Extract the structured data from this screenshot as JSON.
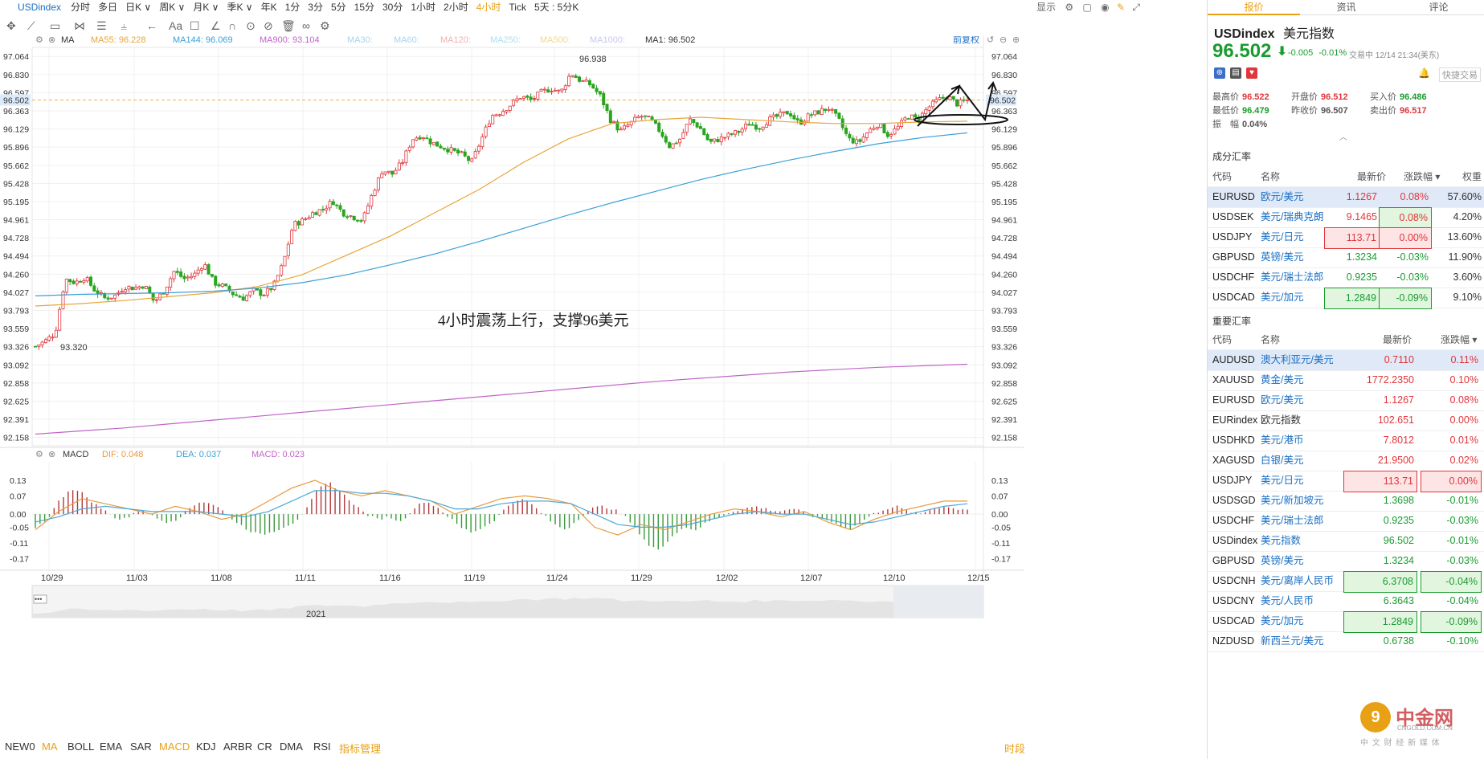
{
  "topbar": {
    "symbol": "USDindex",
    "periods": [
      "分时",
      "多日",
      "日K",
      "周K",
      "月K",
      "季K",
      "年K",
      "1分",
      "3分",
      "5分",
      "15分",
      "30分",
      "1小时",
      "2小时",
      "4小时",
      "Tick",
      "5天 : 5分K"
    ],
    "active_period": "4小时",
    "display": "显示"
  },
  "ma_header": {
    "ma": "MA",
    "ma55": "MA55: 96.228",
    "ma144": "MA144: 96.069",
    "ma900": "MA900: 93.104",
    "ma30": "MA30:",
    "ma60": "MA60:",
    "ma120": "MA120:",
    "ma250": "MA250:",
    "ma500": "MA500:",
    "ma1000": "MA1000:",
    "ma1": "MA1: 96.502",
    "adjust": "前复权"
  },
  "macd_header": {
    "name": "MACD",
    "dif": "DIF: 0.048",
    "dea": "DEA: 0.037",
    "macd": "MACD: 0.023"
  },
  "chart_data": [
    {
      "type": "candlestick",
      "title": "",
      "annotation": "4小时震荡上行，支撑96美元",
      "yticks": [
        97.064,
        96.83,
        96.597,
        96.363,
        96.129,
        95.896,
        95.662,
        95.428,
        95.195,
        94.961,
        94.728,
        94.494,
        94.26,
        94.027,
        93.793,
        93.559,
        93.326,
        93.092,
        92.858,
        92.625,
        92.391,
        92.158
      ],
      "ylim": [
        92.158,
        97.064
      ],
      "current_price": "96.502",
      "high_label": "96.938",
      "low_label": "93.320",
      "xticks": [
        "10/29",
        "11/03",
        "11/08",
        "11/11",
        "11/16",
        "11/19",
        "11/24",
        "11/29",
        "12/02",
        "12/07",
        "12/10",
        "12/15"
      ],
      "close_path": [
        93.33,
        93.4,
        93.5,
        94.2,
        94.15,
        94.22,
        94.05,
        93.95,
        93.98,
        94.1,
        94.08,
        94.12,
        93.9,
        94.05,
        94.3,
        94.2,
        94.25,
        94.4,
        94.15,
        94.1,
        94.0,
        93.95,
        94.05,
        94.0,
        94.1,
        94.4,
        94.9,
        94.95,
        95.05,
        95.1,
        95.2,
        95.05,
        95.0,
        94.95,
        95.3,
        95.6,
        95.55,
        95.7,
        96.0,
        96.05,
        95.95,
        95.9,
        95.85,
        95.8,
        95.7,
        96.0,
        96.3,
        96.35,
        96.45,
        96.55,
        96.5,
        96.6,
        96.65,
        96.6,
        96.85,
        96.75,
        96.7,
        96.55,
        96.25,
        96.1,
        96.2,
        96.3,
        96.25,
        96.1,
        95.9,
        96.0,
        96.25,
        96.15,
        95.95,
        96.0,
        96.05,
        96.1,
        96.2,
        96.15,
        96.25,
        96.3,
        96.35,
        96.2,
        96.3,
        96.35,
        96.4,
        96.25,
        96.0,
        95.95,
        96.1,
        96.2,
        96.05,
        96.15,
        96.3,
        96.25,
        96.4,
        96.5,
        96.55,
        96.45,
        96.5
      ],
      "series": [
        {
          "name": "MA55",
          "color": "#e8a53a",
          "values": [
            93.85,
            93.88,
            93.92,
            93.97,
            94.02,
            94.1,
            94.25,
            94.5,
            94.75,
            95.05,
            95.35,
            95.7,
            96.0,
            96.2,
            96.25,
            96.28,
            96.25,
            96.22,
            96.2,
            96.2,
            96.22,
            96.23
          ]
        },
        {
          "name": "MA144",
          "color": "#3aa0d8",
          "values": [
            93.98,
            94.0,
            94.01,
            94.02,
            94.04,
            94.08,
            94.15,
            94.25,
            94.38,
            94.52,
            94.68,
            94.85,
            95.02,
            95.18,
            95.33,
            95.48,
            95.61,
            95.73,
            95.84,
            95.94,
            96.02,
            96.08
          ]
        },
        {
          "name": "MA900",
          "color": "#c065c8",
          "values": [
            92.2,
            92.24,
            92.28,
            92.33,
            92.38,
            92.43,
            92.48,
            92.53,
            92.58,
            92.63,
            92.68,
            92.73,
            92.78,
            92.83,
            92.88,
            92.92,
            92.96,
            93.0,
            93.03,
            93.06,
            93.08,
            93.1
          ]
        }
      ]
    },
    {
      "type": "bar",
      "title": "MACD",
      "yticks": [
        0.13,
        0.07,
        0.0,
        -0.05,
        -0.11,
        -0.17
      ],
      "ylim": [
        -0.17,
        0.13
      ],
      "histogram": [
        -0.05,
        -0.02,
        0.05,
        0.1,
        0.08,
        0.04,
        0.01,
        -0.02,
        -0.01,
        0.02,
        -0.01,
        -0.03,
        -0.02,
        0.02,
        0.05,
        0.04,
        0.01,
        -0.03,
        -0.06,
        -0.08,
        -0.07,
        -0.05,
        -0.03,
        0.02,
        0.1,
        0.12,
        0.08,
        0.04,
        0.0,
        -0.02,
        -0.01,
        -0.03,
        0.02,
        0.05,
        0.03,
        -0.01,
        -0.05,
        -0.07,
        -0.05,
        -0.02,
        0.03,
        0.06,
        0.04,
        0.0,
        -0.04,
        -0.06,
        -0.02,
        0.02,
        0.03,
        0.02,
        -0.01,
        -0.06,
        -0.12,
        -0.14,
        -0.08,
        -0.05,
        -0.06,
        -0.03,
        -0.01,
        0.01,
        0.02,
        0.03,
        0.02,
        0.01,
        0.02,
        0.01,
        -0.01,
        -0.02,
        -0.04,
        -0.06,
        -0.03,
        0.0,
        0.02,
        0.03,
        0.01,
        0.0,
        0.02,
        0.03,
        0.02,
        0.02
      ],
      "series": [
        {
          "name": "DIF",
          "color": "#e89a3c",
          "values": [
            -0.06,
            0.01,
            0.06,
            0.04,
            0.02,
            0.0,
            0.03,
            0.01,
            -0.02,
            0.0,
            0.05,
            0.1,
            0.13,
            0.09,
            0.07,
            0.09,
            0.07,
            0.05,
            0.0,
            0.03,
            0.06,
            0.07,
            0.06,
            0.04,
            -0.05,
            -0.08,
            -0.04,
            -0.06,
            -0.03,
            0.0,
            0.02,
            0.01,
            -0.01,
            0.01,
            -0.03,
            -0.06,
            -0.02,
            0.01,
            0.03,
            0.05,
            0.05
          ]
        },
        {
          "name": "DEA",
          "color": "#4aa8d8",
          "values": [
            -0.03,
            -0.01,
            0.02,
            0.03,
            0.02,
            0.01,
            0.01,
            0.01,
            0.0,
            -0.01,
            0.01,
            0.05,
            0.09,
            0.09,
            0.08,
            0.08,
            0.07,
            0.05,
            0.02,
            0.02,
            0.04,
            0.05,
            0.05,
            0.04,
            0.0,
            -0.04,
            -0.05,
            -0.05,
            -0.04,
            -0.02,
            0.0,
            0.01,
            0.0,
            0.0,
            -0.02,
            -0.04,
            -0.03,
            -0.01,
            0.01,
            0.03,
            0.04
          ]
        }
      ]
    }
  ],
  "overview": {
    "year": "2021"
  },
  "indicators": [
    "NEW0",
    "MA",
    "BOLL",
    "EMA",
    "SAR",
    "MACD",
    "KDJ",
    "ARBR",
    "CR",
    "DMA",
    "RSI",
    "指标管理"
  ],
  "indicators_active": [
    "MA",
    "MACD",
    "指标管理"
  ],
  "time_label": "时段",
  "side": {
    "tabs": [
      "报价",
      "资讯",
      "评论"
    ],
    "symbol": "USDindex",
    "name": "美元指数",
    "price": "96.502",
    "change": "-0.005",
    "change_pct": "-0.01%",
    "trade_time": "交易中 12/14 21:34(美东)",
    "quick_trade": "快捷交易",
    "stats": [
      {
        "label": "最高价",
        "value": "96.522",
        "color": "red"
      },
      {
        "label": "开盘价",
        "value": "96.512",
        "color": "red"
      },
      {
        "label": "买入价",
        "value": "96.486",
        "color": "grn"
      },
      {
        "label": "最低价",
        "value": "96.479",
        "color": "grn"
      },
      {
        "label": "昨收价",
        "value": "96.507",
        "color": "blk"
      },
      {
        "label": "卖出价",
        "value": "96.517",
        "color": "red"
      },
      {
        "label": "振　幅",
        "value": "0.04%",
        "color": "blk"
      }
    ],
    "components_title": "成分汇率",
    "components_headers": [
      "代码",
      "名称",
      "最新价",
      "涨跌幅",
      "权重"
    ],
    "components": [
      {
        "code": "EURUSD",
        "name": "欧元/美元",
        "price": "1.1267",
        "chg": "0.08%",
        "weight": "57.60%",
        "dir": "up",
        "pbox": "",
        "cbox": ""
      },
      {
        "code": "USDSEK",
        "name": "美元/瑞典克朗",
        "price": "9.1465",
        "chg": "0.08%",
        "weight": "4.20%",
        "dir": "up",
        "pbox": "",
        "cbox": "g"
      },
      {
        "code": "USDJPY",
        "name": "美元/日元",
        "price": "113.71",
        "chg": "0.00%",
        "weight": "13.60%",
        "dir": "up",
        "pbox": "r",
        "cbox": "r"
      },
      {
        "code": "GBPUSD",
        "name": "英镑/美元",
        "price": "1.3234",
        "chg": "-0.03%",
        "weight": "11.90%",
        "dir": "down",
        "pbox": "",
        "cbox": ""
      },
      {
        "code": "USDCHF",
        "name": "美元/瑞士法郎",
        "price": "0.9235",
        "chg": "-0.03%",
        "weight": "3.60%",
        "dir": "down",
        "pbox": "",
        "cbox": ""
      },
      {
        "code": "USDCAD",
        "name": "美元/加元",
        "price": "1.2849",
        "chg": "-0.09%",
        "weight": "9.10%",
        "dir": "down",
        "pbox": "g",
        "cbox": "g"
      }
    ],
    "major_title": "重要汇率",
    "major_headers": [
      "代码",
      "名称",
      "最新价",
      "涨跌幅"
    ],
    "major": [
      {
        "code": "AUDUSD",
        "name": "澳大利亚元/美元",
        "price": "0.7110",
        "chg": "0.11%",
        "dir": "up",
        "pbox": "",
        "cbox": "",
        "link": true
      },
      {
        "code": "XAUUSD",
        "name": "黄金/美元",
        "price": "1772.2350",
        "chg": "0.10%",
        "dir": "up",
        "pbox": "",
        "cbox": "",
        "link": true
      },
      {
        "code": "EURUSD",
        "name": "欧元/美元",
        "price": "1.1267",
        "chg": "0.08%",
        "dir": "up",
        "pbox": "",
        "cbox": "",
        "link": true
      },
      {
        "code": "EURindex",
        "name": "欧元指数",
        "price": "102.651",
        "chg": "0.00%",
        "dir": "up",
        "pbox": "",
        "cbox": "",
        "link": false
      },
      {
        "code": "USDHKD",
        "name": "美元/港币",
        "price": "7.8012",
        "chg": "0.01%",
        "dir": "up",
        "pbox": "",
        "cbox": "",
        "link": true
      },
      {
        "code": "XAGUSD",
        "name": "白银/美元",
        "price": "21.9500",
        "chg": "0.02%",
        "dir": "up",
        "pbox": "",
        "cbox": "",
        "link": true
      },
      {
        "code": "USDJPY",
        "name": "美元/日元",
        "price": "113.71",
        "chg": "0.00%",
        "dir": "up",
        "pbox": "r",
        "cbox": "r",
        "link": true
      },
      {
        "code": "USDSGD",
        "name": "美元/新加坡元",
        "price": "1.3698",
        "chg": "-0.01%",
        "dir": "down",
        "pbox": "",
        "cbox": "",
        "link": true
      },
      {
        "code": "USDCHF",
        "name": "美元/瑞士法郎",
        "price": "0.9235",
        "chg": "-0.03%",
        "dir": "down",
        "pbox": "",
        "cbox": "",
        "link": true
      },
      {
        "code": "USDindex",
        "name": "美元指数",
        "price": "96.502",
        "chg": "-0.01%",
        "dir": "down",
        "pbox": "",
        "cbox": "",
        "link": true
      },
      {
        "code": "GBPUSD",
        "name": "英镑/美元",
        "price": "1.3234",
        "chg": "-0.03%",
        "dir": "down",
        "pbox": "",
        "cbox": "",
        "link": true
      },
      {
        "code": "USDCNH",
        "name": "美元/离岸人民币",
        "price": "6.3708",
        "chg": "-0.04%",
        "dir": "down",
        "pbox": "g",
        "cbox": "g",
        "link": true
      },
      {
        "code": "USDCNY",
        "name": "美元/人民币",
        "price": "6.3643",
        "chg": "-0.04%",
        "dir": "down",
        "pbox": "",
        "cbox": "",
        "link": true
      },
      {
        "code": "USDCAD",
        "name": "美元/加元",
        "price": "1.2849",
        "chg": "-0.09%",
        "dir": "down",
        "pbox": "g",
        "cbox": "g",
        "link": true
      },
      {
        "code": "NZDUSD",
        "name": "新西兰元/美元",
        "price": "0.6738",
        "chg": "-0.10%",
        "dir": "down",
        "pbox": "",
        "cbox": "",
        "link": true
      }
    ]
  },
  "watermark": {
    "brand": "中金网",
    "url": "CNGOLD.COM.CN",
    "slogan": "中 文 财 经 新 媒 体"
  },
  "colors": {
    "up": "#e0363c",
    "down": "#199b2f",
    "accent": "#e8a015",
    "link": "#1a6fc4"
  }
}
